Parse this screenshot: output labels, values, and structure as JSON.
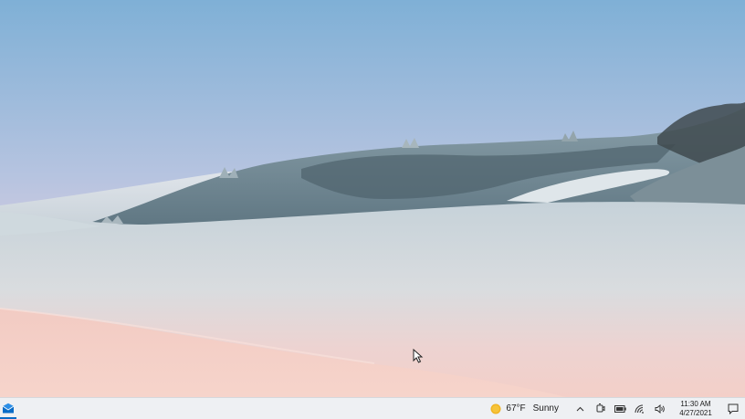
{
  "taskbar": {
    "pinned_apps": [
      {
        "name": "Mail",
        "icon": "mail-icon",
        "active": true
      }
    ],
    "weather": {
      "temperature": "67°F",
      "condition": "Sunny",
      "icon": "sun-icon"
    },
    "tray_icons": [
      "chevron-up-icon",
      "meet-now-icon",
      "battery-icon",
      "wifi-icon",
      "volume-icon"
    ],
    "clock": {
      "time": "11:30 AM",
      "date": "4/27/2021"
    },
    "notifications_icon": "notification-icon"
  },
  "colors": {
    "taskbar_bg": "#eef0f3",
    "accent": "#0a6cc7",
    "sun": "#f0b423"
  }
}
